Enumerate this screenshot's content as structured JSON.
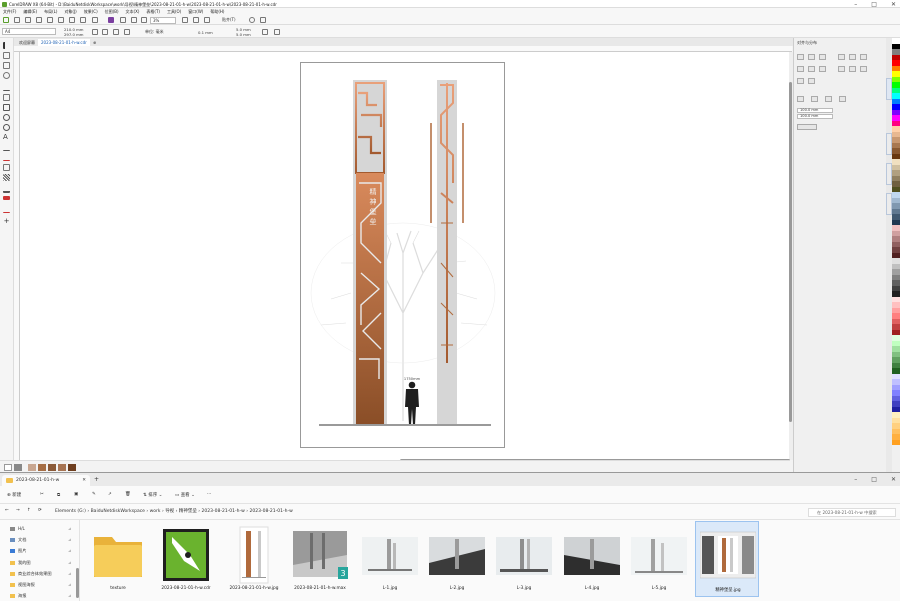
{
  "coreldraw": {
    "title": "CorelDRAW X8 (64-Bit) - D:\\BaiduNetdiskWorkspace\\work\\导视\\精神堡垒\\2023-08-21-01-h-w\\2023-08-21-01-h-w\\2023-08-21-01-h-w.cdr",
    "menus": [
      "文件(F)",
      "编辑(E)",
      "布局(L)",
      "对象(J)",
      "效果(C)",
      "位图(B)",
      "文本(X)",
      "表格(T)",
      "工具(O)",
      "窗口(W)",
      "帮助(H)"
    ],
    "zoom": "3%",
    "snap": "贴齐(T)",
    "page_size": "A4",
    "width": "210.0 mm",
    "height": "297.0 mm",
    "unit_label": "单位:",
    "unit": "毫米",
    "nudge": "0.1 mm",
    "duplicate_x": "5.0 mm",
    "duplicate_y": "5.0 mm",
    "tabs": [
      "欢迎屏幕",
      "2023-08-21-01-h-w.cdr"
    ],
    "docker_title": "对齐与分布",
    "docker_w": "100.0 mm",
    "docker_h": "100.0 mm",
    "figure_label": "1750mm",
    "brand_text": "精神堡垒",
    "side_tabs": [
      "对齐与分布",
      "对象属性",
      "提示",
      "对象管理器"
    ]
  },
  "explorer": {
    "tab_title": "2023-08-21-01-h-w",
    "new_button": "新建",
    "sort_button": "排序",
    "view_button": "查看",
    "more": "···",
    "breadcrumb": [
      "Elements (G:)",
      "BaiduNetdiskWorkspace",
      "work",
      "导视",
      "精神堡垒",
      "2023-08-21-01-h-w",
      "2023-08-21-01-h-w"
    ],
    "search_placeholder": "在 2023-08-21-01-h-w 中搜索",
    "nav": [
      {
        "label": "H/L"
      },
      {
        "label": "文档"
      },
      {
        "label": "图片"
      },
      {
        "label": "我的图"
      },
      {
        "label": "商业综合体效果图"
      },
      {
        "label": "视图海报"
      },
      {
        "label": "海报"
      }
    ],
    "files": [
      {
        "name": "texture",
        "kind": "folder"
      },
      {
        "name": "2023-08-21-01-h-w.cdr",
        "kind": "cdr"
      },
      {
        "name": "2023-08-21-01-h-w.jpg",
        "kind": "jpg-design"
      },
      {
        "name": "2023-08-21-01-h-w.max",
        "kind": "max",
        "badge": "3"
      },
      {
        "name": "L-1.jpg",
        "kind": "render-light"
      },
      {
        "name": "L-2.jpg",
        "kind": "render-dark"
      },
      {
        "name": "L-3.jpg",
        "kind": "render-light"
      },
      {
        "name": "L-4.jpg",
        "kind": "render-dark"
      },
      {
        "name": "L-5.jpg",
        "kind": "render-light"
      },
      {
        "name": "精神堡垒.jpg",
        "kind": "screenshot"
      }
    ]
  },
  "colors": {
    "copper": "#b06a3c",
    "copper_dark": "#6e3e1f",
    "pillar_grey": "#d9d9d9",
    "accent": "#2f7de1"
  }
}
